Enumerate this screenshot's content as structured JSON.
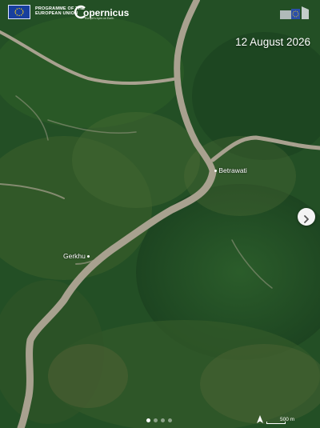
{
  "branding": {
    "program_line1": "PROGRAMME OF THE",
    "program_line2": "EUROPEAN UNION",
    "copernicus_word": "opernicus",
    "copernicus_tagline": "Europe's eyes on Earth"
  },
  "image": {
    "date": "12 August 2026",
    "places": [
      {
        "name": "Betrawati"
      },
      {
        "name": "Gerkhu"
      }
    ]
  },
  "carousel": {
    "slide_count": 4,
    "active_index": 0
  },
  "scale_bar": {
    "label": "500 m"
  },
  "colors": {
    "forest": "#234f25",
    "river": "#a8a18f",
    "text": "#ffffff",
    "eu_blue": "#173f9e",
    "eu_star": "#ffd617"
  },
  "icons": {
    "next": "chevron-right-icon",
    "north": "north-arrow-icon"
  }
}
